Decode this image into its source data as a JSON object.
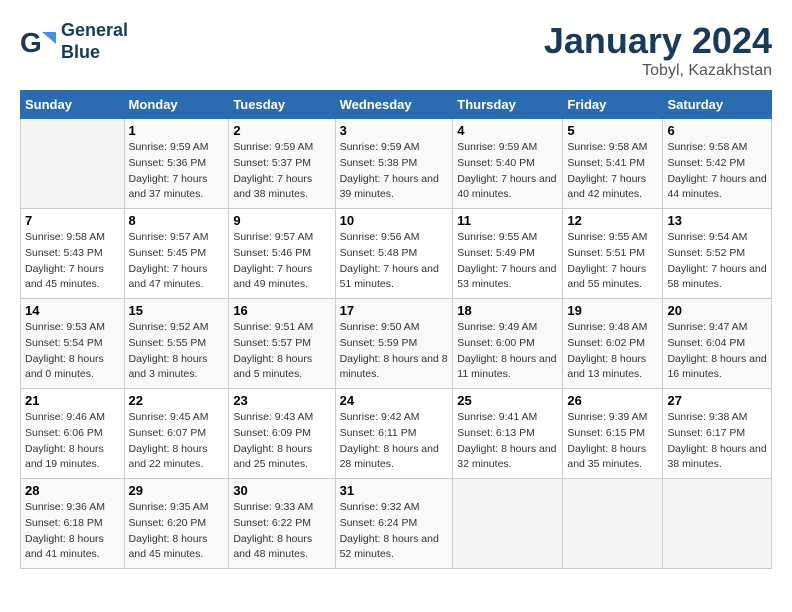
{
  "header": {
    "logo_line1": "General",
    "logo_line2": "Blue",
    "month_title": "January 2024",
    "subtitle": "Tobyl, Kazakhstan"
  },
  "weekdays": [
    "Sunday",
    "Monday",
    "Tuesday",
    "Wednesday",
    "Thursday",
    "Friday",
    "Saturday"
  ],
  "weeks": [
    [
      {
        "day": "",
        "sunrise": "",
        "sunset": "",
        "daylight": ""
      },
      {
        "day": "1",
        "sunrise": "9:59 AM",
        "sunset": "5:36 PM",
        "daylight": "7 hours and 37 minutes."
      },
      {
        "day": "2",
        "sunrise": "9:59 AM",
        "sunset": "5:37 PM",
        "daylight": "7 hours and 38 minutes."
      },
      {
        "day": "3",
        "sunrise": "9:59 AM",
        "sunset": "5:38 PM",
        "daylight": "7 hours and 39 minutes."
      },
      {
        "day": "4",
        "sunrise": "9:59 AM",
        "sunset": "5:40 PM",
        "daylight": "7 hours and 40 minutes."
      },
      {
        "day": "5",
        "sunrise": "9:58 AM",
        "sunset": "5:41 PM",
        "daylight": "7 hours and 42 minutes."
      },
      {
        "day": "6",
        "sunrise": "9:58 AM",
        "sunset": "5:42 PM",
        "daylight": "7 hours and 44 minutes."
      }
    ],
    [
      {
        "day": "7",
        "sunrise": "9:58 AM",
        "sunset": "5:43 PM",
        "daylight": "7 hours and 45 minutes."
      },
      {
        "day": "8",
        "sunrise": "9:57 AM",
        "sunset": "5:45 PM",
        "daylight": "7 hours and 47 minutes."
      },
      {
        "day": "9",
        "sunrise": "9:57 AM",
        "sunset": "5:46 PM",
        "daylight": "7 hours and 49 minutes."
      },
      {
        "day": "10",
        "sunrise": "9:56 AM",
        "sunset": "5:48 PM",
        "daylight": "7 hours and 51 minutes."
      },
      {
        "day": "11",
        "sunrise": "9:55 AM",
        "sunset": "5:49 PM",
        "daylight": "7 hours and 53 minutes."
      },
      {
        "day": "12",
        "sunrise": "9:55 AM",
        "sunset": "5:51 PM",
        "daylight": "7 hours and 55 minutes."
      },
      {
        "day": "13",
        "sunrise": "9:54 AM",
        "sunset": "5:52 PM",
        "daylight": "7 hours and 58 minutes."
      }
    ],
    [
      {
        "day": "14",
        "sunrise": "9:53 AM",
        "sunset": "5:54 PM",
        "daylight": "8 hours and 0 minutes."
      },
      {
        "day": "15",
        "sunrise": "9:52 AM",
        "sunset": "5:55 PM",
        "daylight": "8 hours and 3 minutes."
      },
      {
        "day": "16",
        "sunrise": "9:51 AM",
        "sunset": "5:57 PM",
        "daylight": "8 hours and 5 minutes."
      },
      {
        "day": "17",
        "sunrise": "9:50 AM",
        "sunset": "5:59 PM",
        "daylight": "8 hours and 8 minutes."
      },
      {
        "day": "18",
        "sunrise": "9:49 AM",
        "sunset": "6:00 PM",
        "daylight": "8 hours and 11 minutes."
      },
      {
        "day": "19",
        "sunrise": "9:48 AM",
        "sunset": "6:02 PM",
        "daylight": "8 hours and 13 minutes."
      },
      {
        "day": "20",
        "sunrise": "9:47 AM",
        "sunset": "6:04 PM",
        "daylight": "8 hours and 16 minutes."
      }
    ],
    [
      {
        "day": "21",
        "sunrise": "9:46 AM",
        "sunset": "6:06 PM",
        "daylight": "8 hours and 19 minutes."
      },
      {
        "day": "22",
        "sunrise": "9:45 AM",
        "sunset": "6:07 PM",
        "daylight": "8 hours and 22 minutes."
      },
      {
        "day": "23",
        "sunrise": "9:43 AM",
        "sunset": "6:09 PM",
        "daylight": "8 hours and 25 minutes."
      },
      {
        "day": "24",
        "sunrise": "9:42 AM",
        "sunset": "6:11 PM",
        "daylight": "8 hours and 28 minutes."
      },
      {
        "day": "25",
        "sunrise": "9:41 AM",
        "sunset": "6:13 PM",
        "daylight": "8 hours and 32 minutes."
      },
      {
        "day": "26",
        "sunrise": "9:39 AM",
        "sunset": "6:15 PM",
        "daylight": "8 hours and 35 minutes."
      },
      {
        "day": "27",
        "sunrise": "9:38 AM",
        "sunset": "6:17 PM",
        "daylight": "8 hours and 38 minutes."
      }
    ],
    [
      {
        "day": "28",
        "sunrise": "9:36 AM",
        "sunset": "6:18 PM",
        "daylight": "8 hours and 41 minutes."
      },
      {
        "day": "29",
        "sunrise": "9:35 AM",
        "sunset": "6:20 PM",
        "daylight": "8 hours and 45 minutes."
      },
      {
        "day": "30",
        "sunrise": "9:33 AM",
        "sunset": "6:22 PM",
        "daylight": "8 hours and 48 minutes."
      },
      {
        "day": "31",
        "sunrise": "9:32 AM",
        "sunset": "6:24 PM",
        "daylight": "8 hours and 52 minutes."
      },
      {
        "day": "",
        "sunrise": "",
        "sunset": "",
        "daylight": ""
      },
      {
        "day": "",
        "sunrise": "",
        "sunset": "",
        "daylight": ""
      },
      {
        "day": "",
        "sunrise": "",
        "sunset": "",
        "daylight": ""
      }
    ]
  ]
}
